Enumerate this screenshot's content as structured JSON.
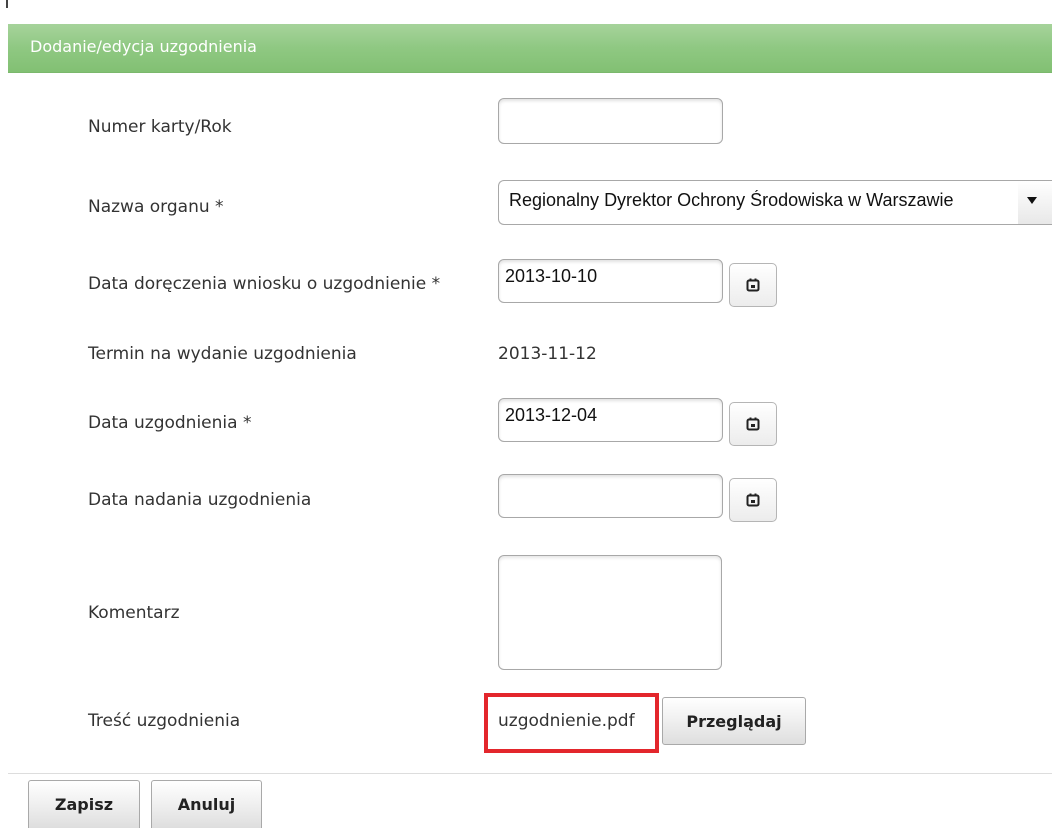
{
  "header": {
    "title": "Dodanie/edycja uzgodnienia"
  },
  "form": {
    "card_number": {
      "label": "Numer karty/Rok",
      "value": ""
    },
    "authority_name": {
      "label": "Nazwa organu *",
      "selected": "Regionalny Dyrektor Ochrony Środowiska w Warszawie"
    },
    "delivery_date": {
      "label": "Data doręczenia wniosku o uzgodnienie *",
      "value": "2013-10-10"
    },
    "deadline": {
      "label": "Termin na wydanie uzgodnienia",
      "value": "2013-11-12"
    },
    "agreement_date": {
      "label": "Data uzgodnienia *",
      "value": "2013-12-04"
    },
    "dispatch_date": {
      "label": "Data nadania uzgodnienia",
      "value": ""
    },
    "comment": {
      "label": "Komentarz",
      "value": ""
    },
    "content": {
      "label": "Treść uzgodnienia",
      "file_name": "uzgodnienie.pdf",
      "browse_label": "Przeglądaj"
    }
  },
  "footer": {
    "save_label": "Zapisz",
    "cancel_label": "Anuluj"
  },
  "icons": {
    "calendar": "calendar-icon",
    "dropdown": "chevron-down-icon"
  },
  "colors": {
    "header_green": "#8fc882",
    "highlight_red": "#e3262c"
  }
}
